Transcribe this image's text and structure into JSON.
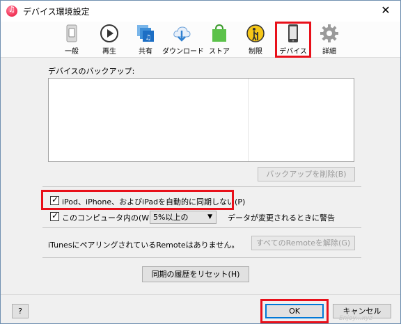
{
  "window": {
    "title": "デバイス環境設定",
    "close_glyph": "✕"
  },
  "toolbar": {
    "items": [
      {
        "label": "一般",
        "icon": "general-switch-icon"
      },
      {
        "label": "再生",
        "icon": "play-icon"
      },
      {
        "label": "共有",
        "icon": "sharing-icon"
      },
      {
        "label": "ダウンロード",
        "icon": "download-cloud-icon"
      },
      {
        "label": "ストア",
        "icon": "store-bag-icon"
      },
      {
        "label": "制限",
        "icon": "parental-restrictions-icon"
      },
      {
        "label": "デバイス",
        "icon": "device-iphone-icon",
        "selected": true
      },
      {
        "label": "詳細",
        "icon": "advanced-gear-icon"
      }
    ]
  },
  "backup": {
    "label": "デバイスのバックアップ:",
    "delete_button": "バックアップを削除(B)"
  },
  "sync": {
    "no_auto_sync_label": "iPod、iPhone、およびiPadを自動的に同期しない(P)",
    "no_auto_sync_checked": true,
    "warn_label_prefix": "このコンピュータ内の(W)",
    "warn_select_value": "5%以上の",
    "warn_label_suffix": "データが変更されるときに警告",
    "warn_checked": true
  },
  "remote": {
    "status_text": "iTunesにペアリングされているRemoteはありません。",
    "unpair_button": "すべてのRemoteを解除(G)"
  },
  "reset_sync_history_button": "同期の履歴をリセット(H)",
  "footer": {
    "help_button": "?",
    "ok_button": "OK",
    "cancel_button": "キャンセル",
    "watermark": "Enjoy...xyz"
  },
  "colors": {
    "highlight_red": "#e8101a",
    "ok_border": "#0078d7"
  }
}
